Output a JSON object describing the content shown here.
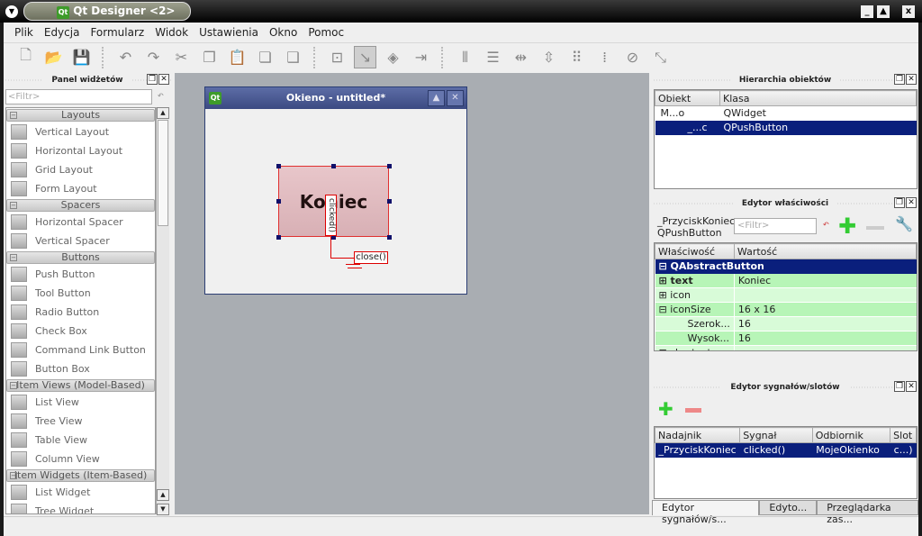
{
  "window": {
    "title": "Qt Designer <2>",
    "minimize": "_",
    "maximize": "▲",
    "close": "x"
  },
  "menu": [
    "Plik",
    "Edycja",
    "Formularz",
    "Widok",
    "Ustawienia",
    "Okno",
    "Pomoc"
  ],
  "toolbar": [
    {
      "icon": "new-file-icon",
      "g": "🗋"
    },
    {
      "icon": "open-folder-icon",
      "g": "📂"
    },
    {
      "icon": "save-icon",
      "g": "💾"
    },
    {
      "sep": true
    },
    {
      "icon": "undo-icon",
      "g": "↶"
    },
    {
      "icon": "redo-icon",
      "g": "↷"
    },
    {
      "icon": "cut-icon",
      "g": "✂"
    },
    {
      "icon": "copy-icon",
      "g": "❐"
    },
    {
      "icon": "paste-icon",
      "g": "📋"
    },
    {
      "icon": "send-to-back-icon",
      "g": "❏"
    },
    {
      "icon": "bring-to-front-icon",
      "g": "❑"
    },
    {
      "sep": true
    },
    {
      "icon": "edit-widgets-icon",
      "g": "⊡"
    },
    {
      "icon": "edit-signals-slots-icon",
      "g": "↘",
      "active": true
    },
    {
      "icon": "edit-buddies-icon",
      "g": "◈"
    },
    {
      "icon": "edit-tab-order-icon",
      "g": "⇥"
    },
    {
      "sep": true
    },
    {
      "icon": "layout-horizontal-icon",
      "g": "⦀"
    },
    {
      "icon": "layout-vertical-icon",
      "g": "☰"
    },
    {
      "icon": "layout-h-splitter-icon",
      "g": "⇹"
    },
    {
      "icon": "layout-v-splitter-icon",
      "g": "⇳"
    },
    {
      "icon": "layout-grid-icon",
      "g": "⠿"
    },
    {
      "icon": "layout-form-icon",
      "g": "⁞"
    },
    {
      "icon": "break-layout-icon",
      "g": "⊘"
    },
    {
      "icon": "adjust-size-icon",
      "g": "⤡"
    }
  ],
  "widget_box": {
    "title": "Panel widżetów",
    "filter_placeholder": "<Filtr>",
    "categories": [
      {
        "name": "Layouts",
        "items": [
          "Vertical Layout",
          "Horizontal Layout",
          "Grid Layout",
          "Form Layout"
        ]
      },
      {
        "name": "Spacers",
        "items": [
          "Horizontal Spacer",
          "Vertical Spacer"
        ]
      },
      {
        "name": "Buttons",
        "items": [
          "Push Button",
          "Tool Button",
          "Radio Button",
          "Check Box",
          "Command Link Button",
          "Button Box"
        ]
      },
      {
        "name": "Item Views (Model-Based)",
        "items": [
          "List View",
          "Tree View",
          "Table View",
          "Column View"
        ]
      },
      {
        "name": "Item Widgets (Item-Based)",
        "items": [
          "List Widget",
          "Tree Widget"
        ]
      }
    ]
  },
  "form": {
    "title": "Okieno - untitled*",
    "button_text": "Koniec",
    "signal": "clicked()",
    "slot": "close()"
  },
  "object_inspector": {
    "title": "Hierarchia obiektów",
    "columns": [
      "Obiekt",
      "Klasa"
    ],
    "rows": [
      {
        "object": "M...o",
        "class": "QWidget"
      },
      {
        "object": "_...c",
        "class": "QPushButton",
        "selected": true
      }
    ]
  },
  "property_editor": {
    "title": "Edytor właściwości",
    "object_name": "_PrzyciskKoniec",
    "object_class": "QPushButton",
    "filter_placeholder": "<Filtr>",
    "columns": [
      "Właściwość",
      "Wartość"
    ],
    "group": "QAbstractButton",
    "rows": [
      {
        "name": "text",
        "value": "Koniec",
        "bold": true,
        "exp": "⊞"
      },
      {
        "name": "icon",
        "value": "",
        "exp": "⊞"
      },
      {
        "name": "iconSize",
        "value": "16 x 16",
        "exp": "⊟"
      },
      {
        "name": "Szerok...",
        "value": "16",
        "child": true
      },
      {
        "name": "Wysok...",
        "value": "16",
        "child": true
      },
      {
        "name": "shortcut",
        "value": "",
        "exp": "⊟"
      }
    ]
  },
  "signal_slot_editor": {
    "title": "Edytor sygnałów/slotów",
    "columns": [
      "Nadajnik",
      "Sygnał",
      "Odbiornik",
      "Slot"
    ],
    "rows": [
      {
        "sender": "_PrzyciskKoniec",
        "signal": "clicked()",
        "receiver": "MojeOkienko",
        "slot": "c...)"
      }
    ]
  },
  "bottom_tabs": [
    "Edytor sygnałów/s...",
    "Edyto...",
    "Przeglądarka zas..."
  ],
  "colors": {
    "selection": "#0a1f7c",
    "property_green": "#b7f5b7",
    "connection_red": "#e03030"
  }
}
